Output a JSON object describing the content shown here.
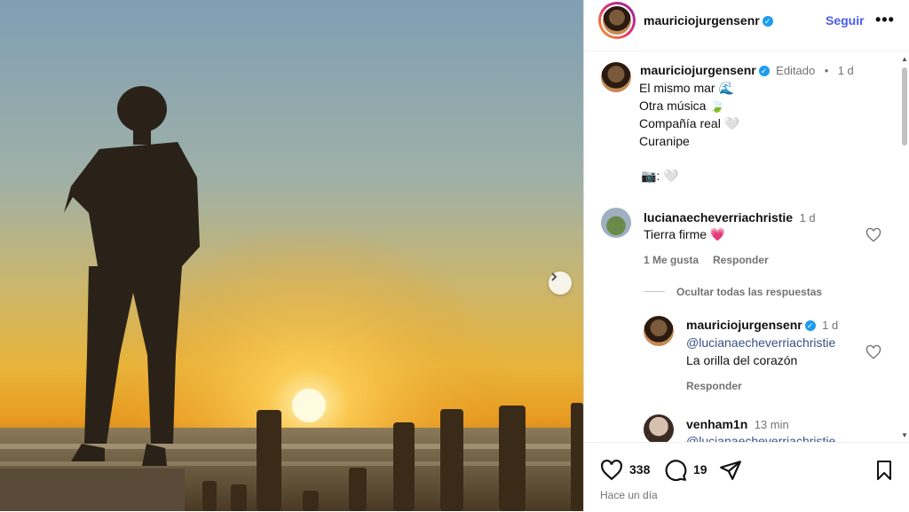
{
  "post_author": {
    "username": "mauriciojurgensenr",
    "follow_label": "Seguir",
    "more_label": "•••"
  },
  "caption": {
    "username": "mauriciojurgensenr",
    "edited_label": "Editado",
    "separator": "•",
    "time": "1 d",
    "lines": [
      "El mismo mar 🌊",
      "Otra música 🍃",
      "Compañía real 🤍",
      "Curanipe"
    ],
    "extra_line": "📷: 🤍"
  },
  "comments": [
    {
      "username": "lucianaecheverriachristie",
      "time": "1 d",
      "text": "Tierra firme 💗",
      "likes_label": "1 Me gusta",
      "reply_label": "Responder",
      "hide_replies_label": "Ocultar todas las respuestas"
    }
  ],
  "replies": [
    {
      "username": "mauriciojurgensenr",
      "time": "1 d",
      "mention": "@lucianaecheverriachristie",
      "text": "La orilla del corazón",
      "reply_label": "Responder"
    },
    {
      "username": "venham1n",
      "time": "13 min",
      "mention": "@lucianaecheverriachristie"
    }
  ],
  "footer": {
    "likes_count": "338",
    "comments_count": "19",
    "time_ago": "Hace un día"
  },
  "icons": {
    "next": "chevron-right-icon",
    "like": "heart-icon",
    "comment": "comment-icon",
    "share": "send-icon",
    "save": "bookmark-icon"
  },
  "colors": {
    "follow": "#4a5df0",
    "verified": "#1d9bf0",
    "heart": "#ff3b6b"
  }
}
